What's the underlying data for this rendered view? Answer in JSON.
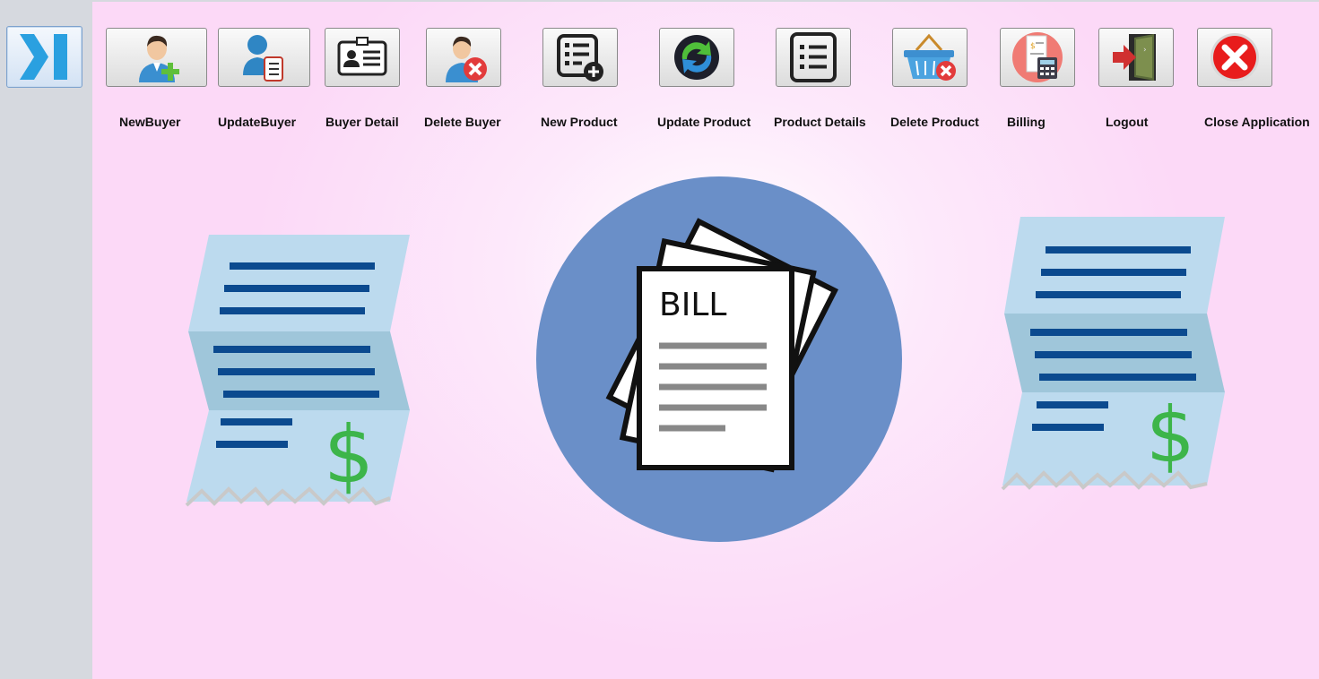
{
  "toolbar": {
    "items": [
      {
        "label": "NewBuyer",
        "icon": "add-user-icon"
      },
      {
        "label": "UpdateBuyer",
        "icon": "update-user-icon"
      },
      {
        "label": "Buyer Detail",
        "icon": "id-card-icon"
      },
      {
        "label": "Delete Buyer",
        "icon": "delete-user-icon"
      },
      {
        "label": "New Product",
        "icon": "add-list-icon"
      },
      {
        "label": "Update Product",
        "icon": "refresh-icon"
      },
      {
        "label": "Product Details",
        "icon": "list-icon"
      },
      {
        "label": "Delete Product",
        "icon": "delete-basket-icon"
      },
      {
        "label": "Billing",
        "icon": "billing-calculator-icon"
      },
      {
        "label": "Logout",
        "icon": "logout-door-icon"
      },
      {
        "label": "Close Application",
        "icon": "close-icon"
      }
    ]
  },
  "sidebar": {
    "toggle_icon": "collapse-sidebar-icon"
  },
  "hero": {
    "bill_text": "BILL",
    "currency_symbol": "$"
  },
  "colors": {
    "background_pink": "#fcd9f7",
    "circle_blue": "#6a8fc8",
    "receipt_light": "#bcdaee",
    "receipt_mid": "#9fc6da",
    "receipt_line": "#0b4a8f",
    "dollar_green": "#3db54a"
  }
}
